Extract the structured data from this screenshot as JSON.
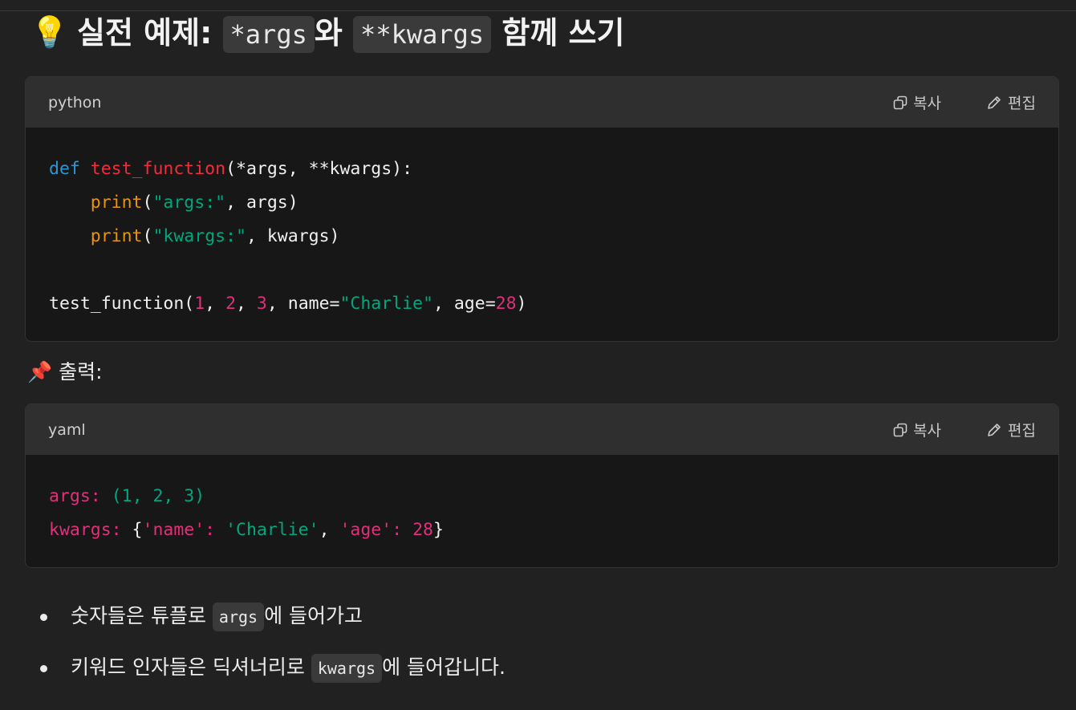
{
  "heading": {
    "icon": "lightbulb-icon",
    "emoji": "💡",
    "prefix": "실전 예제:",
    "code1": "*args",
    "mid": "와",
    "code2": "**kwargs",
    "suffix": "함께 쓰기"
  },
  "code_block_1": {
    "language": "python",
    "copy_label": "복사",
    "edit_label": "편집",
    "lines": [
      [
        {
          "t": "def",
          "c": "kw"
        },
        {
          "t": " "
        },
        {
          "t": "test_function",
          "c": "fn"
        },
        {
          "t": "(*args, **kwargs):"
        }
      ],
      [
        {
          "t": "    "
        },
        {
          "t": "print",
          "c": "bi"
        },
        {
          "t": "("
        },
        {
          "t": "\"args:\"",
          "c": "st"
        },
        {
          "t": ", args)"
        }
      ],
      [
        {
          "t": "    "
        },
        {
          "t": "print",
          "c": "bi"
        },
        {
          "t": "("
        },
        {
          "t": "\"kwargs:\"",
          "c": "st"
        },
        {
          "t": ", kwargs)"
        }
      ],
      [
        {
          "t": ""
        }
      ],
      [
        {
          "t": "test_function("
        },
        {
          "t": "1",
          "c": "nm"
        },
        {
          "t": ", "
        },
        {
          "t": "2",
          "c": "nm"
        },
        {
          "t": ", "
        },
        {
          "t": "3",
          "c": "nm"
        },
        {
          "t": ", name="
        },
        {
          "t": "\"Charlie\"",
          "c": "st"
        },
        {
          "t": ", age="
        },
        {
          "t": "28",
          "c": "nm"
        },
        {
          "t": ")"
        }
      ]
    ]
  },
  "output_label": {
    "icon": "pushpin-icon",
    "emoji": "📌",
    "text": "출력:"
  },
  "code_block_2": {
    "language": "yaml",
    "copy_label": "복사",
    "edit_label": "편집",
    "lines": [
      [
        {
          "t": "args:",
          "c": "yk"
        },
        {
          "t": " "
        },
        {
          "t": "(1, 2, 3)",
          "c": "st"
        }
      ],
      [
        {
          "t": "kwargs:",
          "c": "yk"
        },
        {
          "t": " {"
        },
        {
          "t": "'name'",
          "c": "yk"
        },
        {
          "t": ": ",
          "c": "yk"
        },
        {
          "t": "'Charlie'",
          "c": "st"
        },
        {
          "t": ", "
        },
        {
          "t": "'age'",
          "c": "yk"
        },
        {
          "t": ": ",
          "c": "yk"
        },
        {
          "t": "28",
          "c": "yk"
        },
        {
          "t": "}"
        }
      ]
    ]
  },
  "notes": [
    {
      "before": "숫자들은 튜플로 ",
      "code": "args",
      "after": "에 들어가고"
    },
    {
      "before": "키워드 인자들은 딕셔너리로 ",
      "code": "kwargs",
      "after": "에 들어갑니다."
    }
  ]
}
